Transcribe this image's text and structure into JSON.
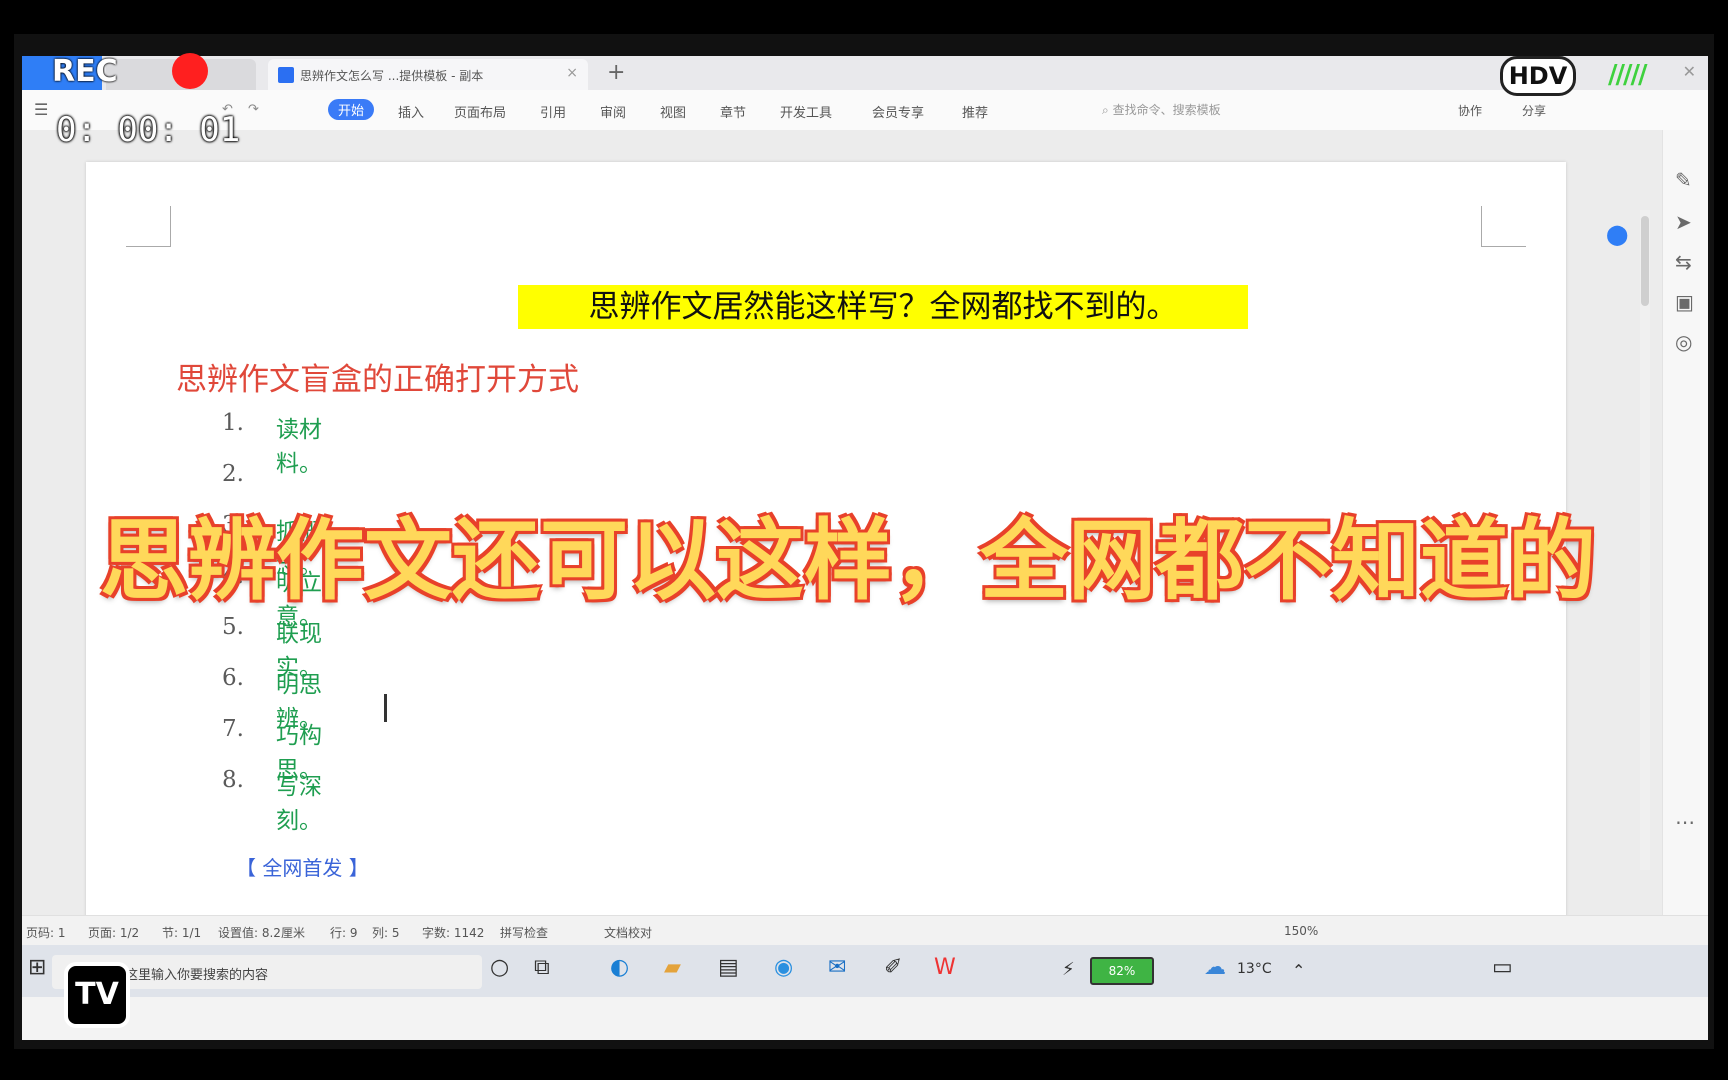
{
  "overlay": {
    "rec_label": "REC",
    "timer": "0: 00: 01",
    "hdv_label": "HDV",
    "tv_label": "TV",
    "banner": "思辨作文还可以这样，全网都不知道的"
  },
  "tabs": {
    "active_label": "思辨作文怎么写 ...提供模板 - 副本",
    "close_glyph": "×",
    "add_glyph": "+"
  },
  "ribbon": {
    "items": [
      "开始",
      "插入",
      "页面布局",
      "引用",
      "审阅",
      "视图",
      "章节",
      "开发工具",
      "会员专享",
      "推荐"
    ],
    "search_placeholder": "查找命令、搜索模板",
    "right_items": [
      "协作",
      "分享"
    ]
  },
  "document": {
    "title": "思辨作文居然能这样写？全网都找不到的。",
    "subtitle": "思辨作文盲盒的正确打开方式",
    "list": [
      {
        "num": "1.",
        "text": "读材料。"
      },
      {
        "num": "2.",
        "text": ""
      },
      {
        "num": "3.",
        "text": "抓概念。"
      },
      {
        "num": "4.",
        "text": "明立意。"
      },
      {
        "num": "5.",
        "text": "联现实。"
      },
      {
        "num": "6.",
        "text": "明思辨。"
      },
      {
        "num": "7.",
        "text": "巧构思。"
      },
      {
        "num": "8.",
        "text": "写深刻。"
      }
    ],
    "more_link": "【 全网首发 】"
  },
  "statusbar": {
    "page": "页码: 1",
    "pages": "页面: 1/2",
    "section": "节: 1/1",
    "setting": "设置值: 8.2厘米",
    "row": "行: 9",
    "col": "列: 5",
    "words": "字数: 1142",
    "spell": "拼写检查",
    "proof": "文档校对",
    "zoom": "150%"
  },
  "taskbar": {
    "search_text": "在这里输入你要搜索的内容",
    "battery": "82%",
    "weather": "13°C"
  }
}
